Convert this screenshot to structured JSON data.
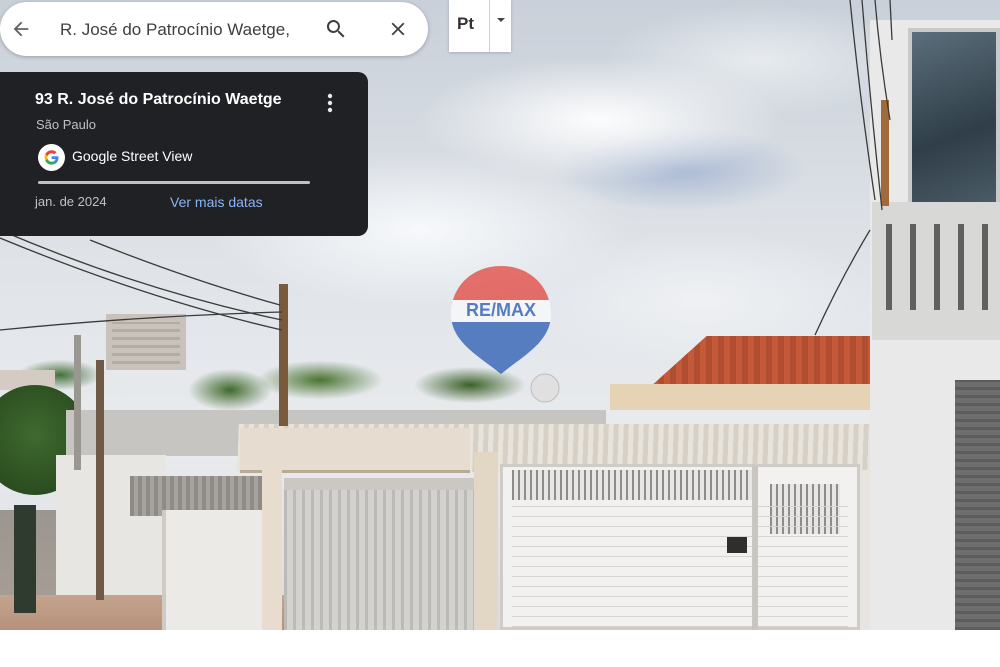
{
  "search": {
    "value": "R. José do Patrocínio Waetge,",
    "back_icon": "arrow-left-icon",
    "search_icon": "search-icon",
    "close_icon": "close-icon"
  },
  "layer_toggle": {
    "label": "Pt",
    "arrow_icon": "caret-down-icon"
  },
  "info_card": {
    "address": "93 R. José do Patrocínio Waetge",
    "city": "São Paulo",
    "provider": "Google Street View",
    "date": "jan. de 2024",
    "more_dates_link": "Ver mais datas",
    "more_icon": "more-vert-icon",
    "logo_icon": "google-g-icon"
  },
  "watermark": {
    "text": "RE/MAX",
    "colors": {
      "top": "#e2231a",
      "bottom": "#003da5"
    }
  },
  "colors": {
    "card_bg": "#202124",
    "link": "#8ab4f8"
  }
}
